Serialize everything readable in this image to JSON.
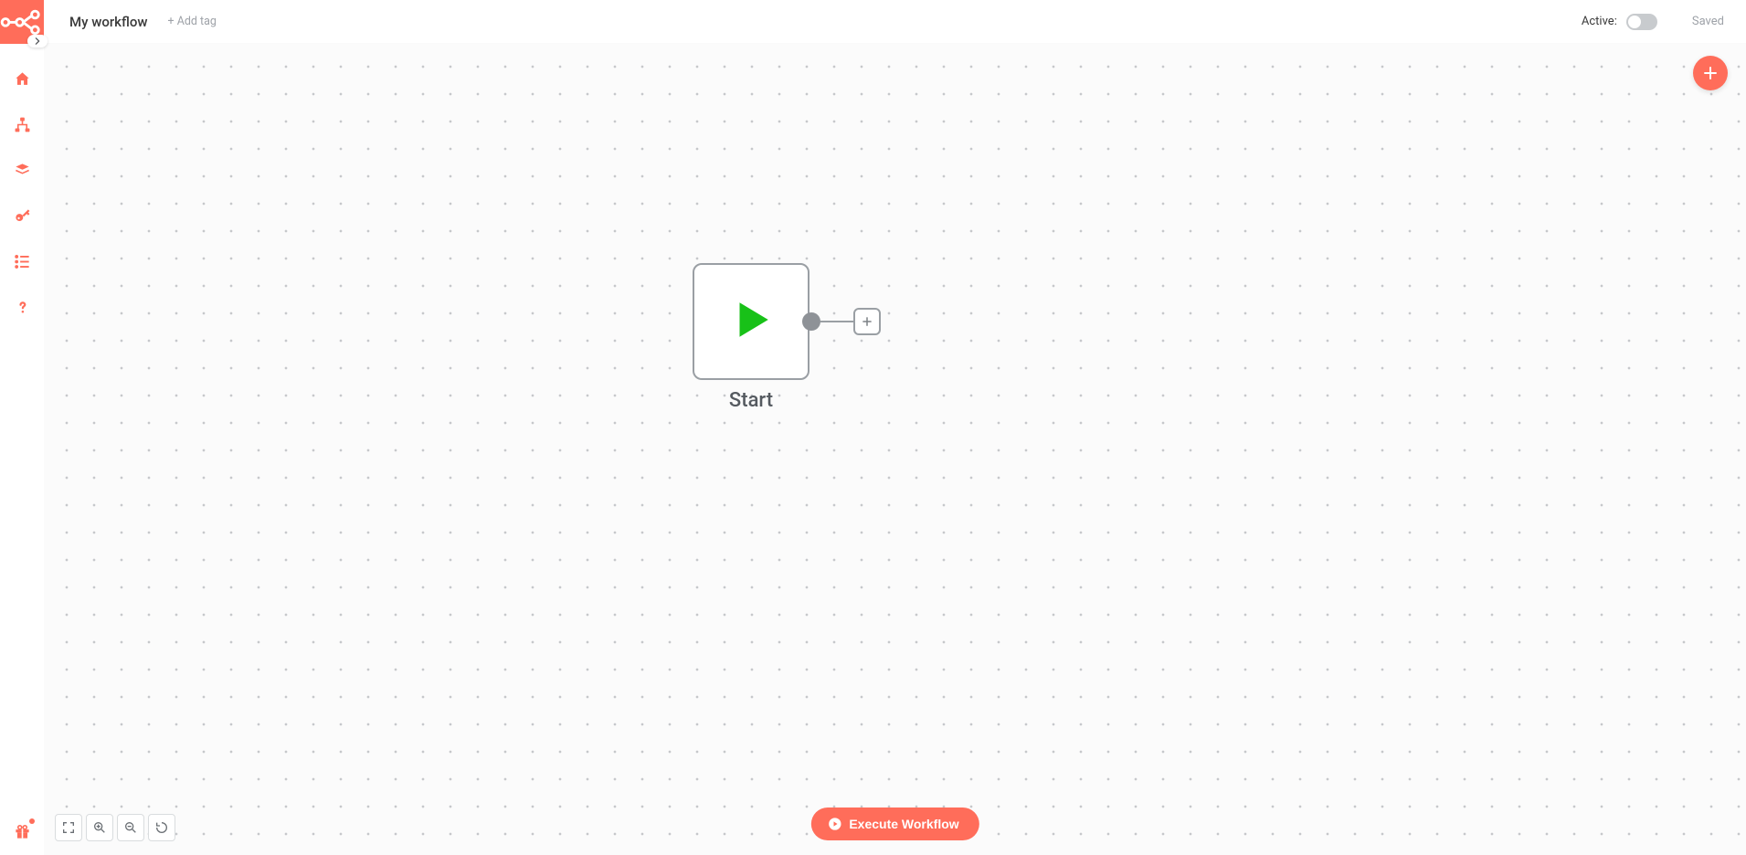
{
  "header": {
    "workflow_title": "My workflow",
    "add_tag_label": "+ Add tag",
    "active_label": "Active:",
    "active_state": false,
    "save_state_label": "Saved"
  },
  "sidebar": {
    "items": [
      {
        "name": "home-icon"
      },
      {
        "name": "workflows-icon"
      },
      {
        "name": "templates-icon"
      },
      {
        "name": "credentials-icon"
      },
      {
        "name": "executions-icon"
      },
      {
        "name": "help-icon"
      }
    ],
    "bottom_item": {
      "name": "gift-icon"
    }
  },
  "canvas": {
    "start_node_label": "Start"
  },
  "controls": {
    "execute_label": "Execute Workflow",
    "zoom": [
      {
        "name": "fit-view-icon"
      },
      {
        "name": "zoom-in-icon"
      },
      {
        "name": "zoom-out-icon"
      },
      {
        "name": "reset-zoom-icon"
      }
    ]
  }
}
